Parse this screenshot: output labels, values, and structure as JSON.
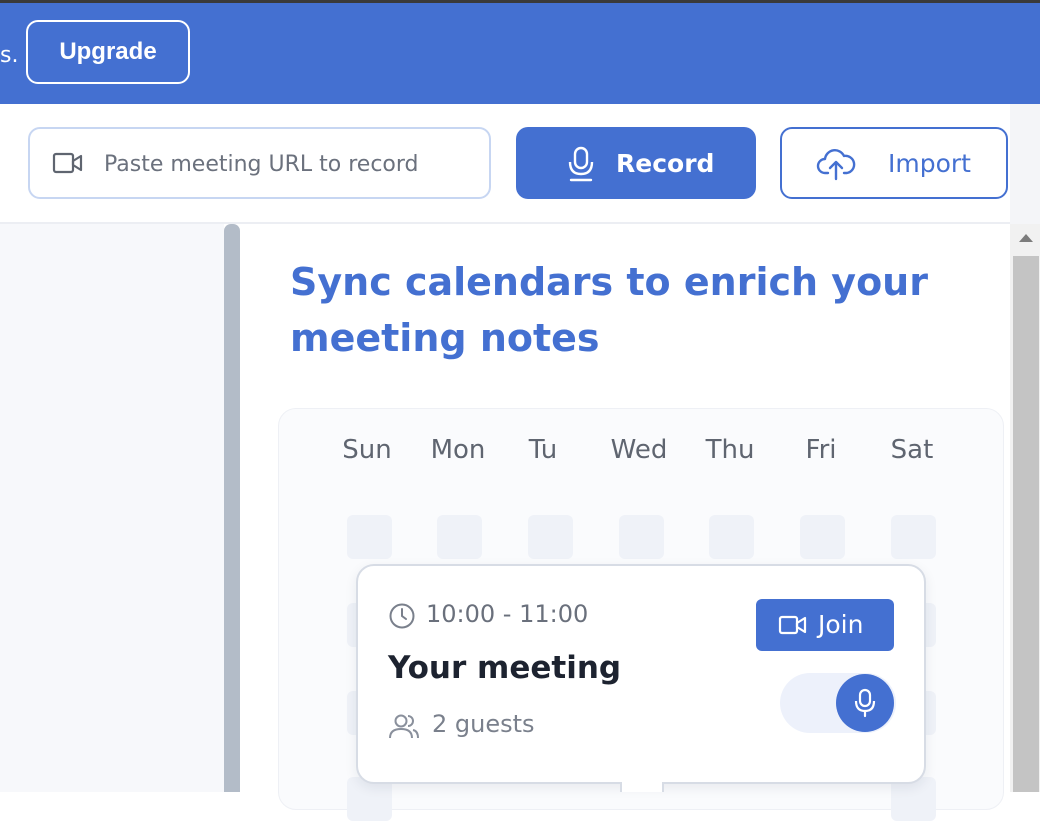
{
  "banner": {
    "partial_text": "s.",
    "upgrade_label": "Upgrade"
  },
  "toolbar": {
    "url_placeholder": "Paste meeting URL to record",
    "record_label": "Record",
    "import_label": "Import"
  },
  "content": {
    "heading_line1": "Sync calendars to enrich your",
    "heading_line2": "meeting notes",
    "days": [
      "Sun",
      "Mon",
      "Tu",
      "Wed",
      "Thu",
      "Fri",
      "Sat"
    ]
  },
  "meeting": {
    "time": "10:00 - 11:00",
    "title": "Your meeting",
    "guests": "2 guests",
    "join_label": "Join"
  },
  "colors": {
    "accent": "#4470d1",
    "banner": "#4470d1"
  },
  "icons": [
    "video-camera-icon",
    "microphone-icon",
    "cloud-upload-icon",
    "clock-icon",
    "users-icon"
  ]
}
